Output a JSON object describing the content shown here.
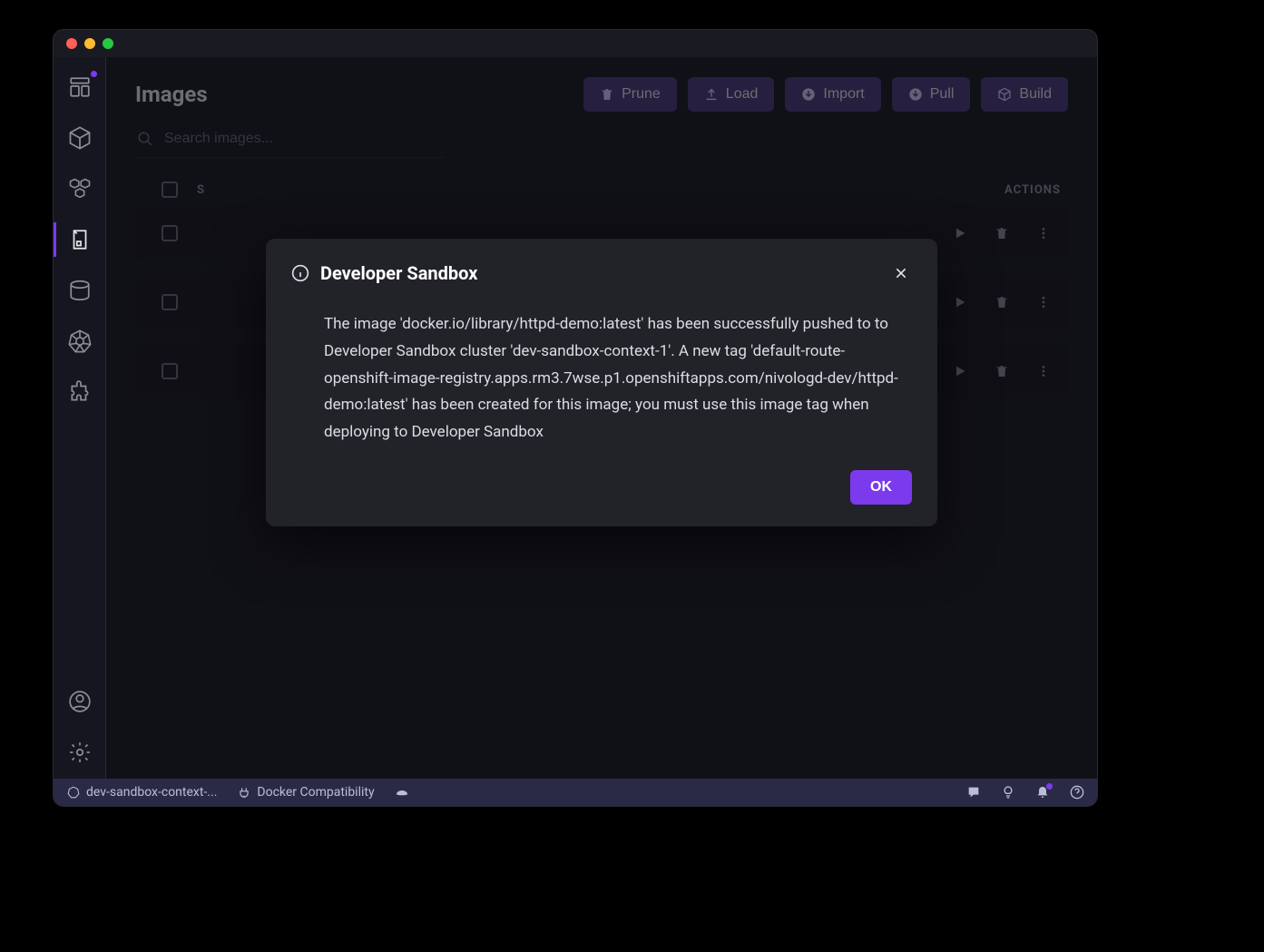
{
  "page": {
    "title": "Images"
  },
  "toolbar": {
    "prune": "Prune",
    "load": "Load",
    "import": "Import",
    "pull": "Pull",
    "build": "Build"
  },
  "search": {
    "placeholder": "Search images..."
  },
  "table": {
    "headers": {
      "status": "S",
      "actions": "ACTIONS"
    },
    "rows": [
      {},
      {},
      {}
    ]
  },
  "modal": {
    "title": "Developer Sandbox",
    "body": "The image 'docker.io/library/httpd-demo:latest' has been successfully pushed to to Developer Sandbox cluster 'dev-sandbox-context-1'. A new tag 'default-route-openshift-image-registry.apps.rm3.7wse.p1.openshiftapps.com/nivologd-dev/httpd-demo:latest' has been created for this image; you must use this image tag when deploying to Developer Sandbox",
    "ok": "OK"
  },
  "statusbar": {
    "context": "dev-sandbox-context-...",
    "docker": "Docker Compatibility"
  },
  "colors": {
    "accent": "#7c3aed"
  }
}
